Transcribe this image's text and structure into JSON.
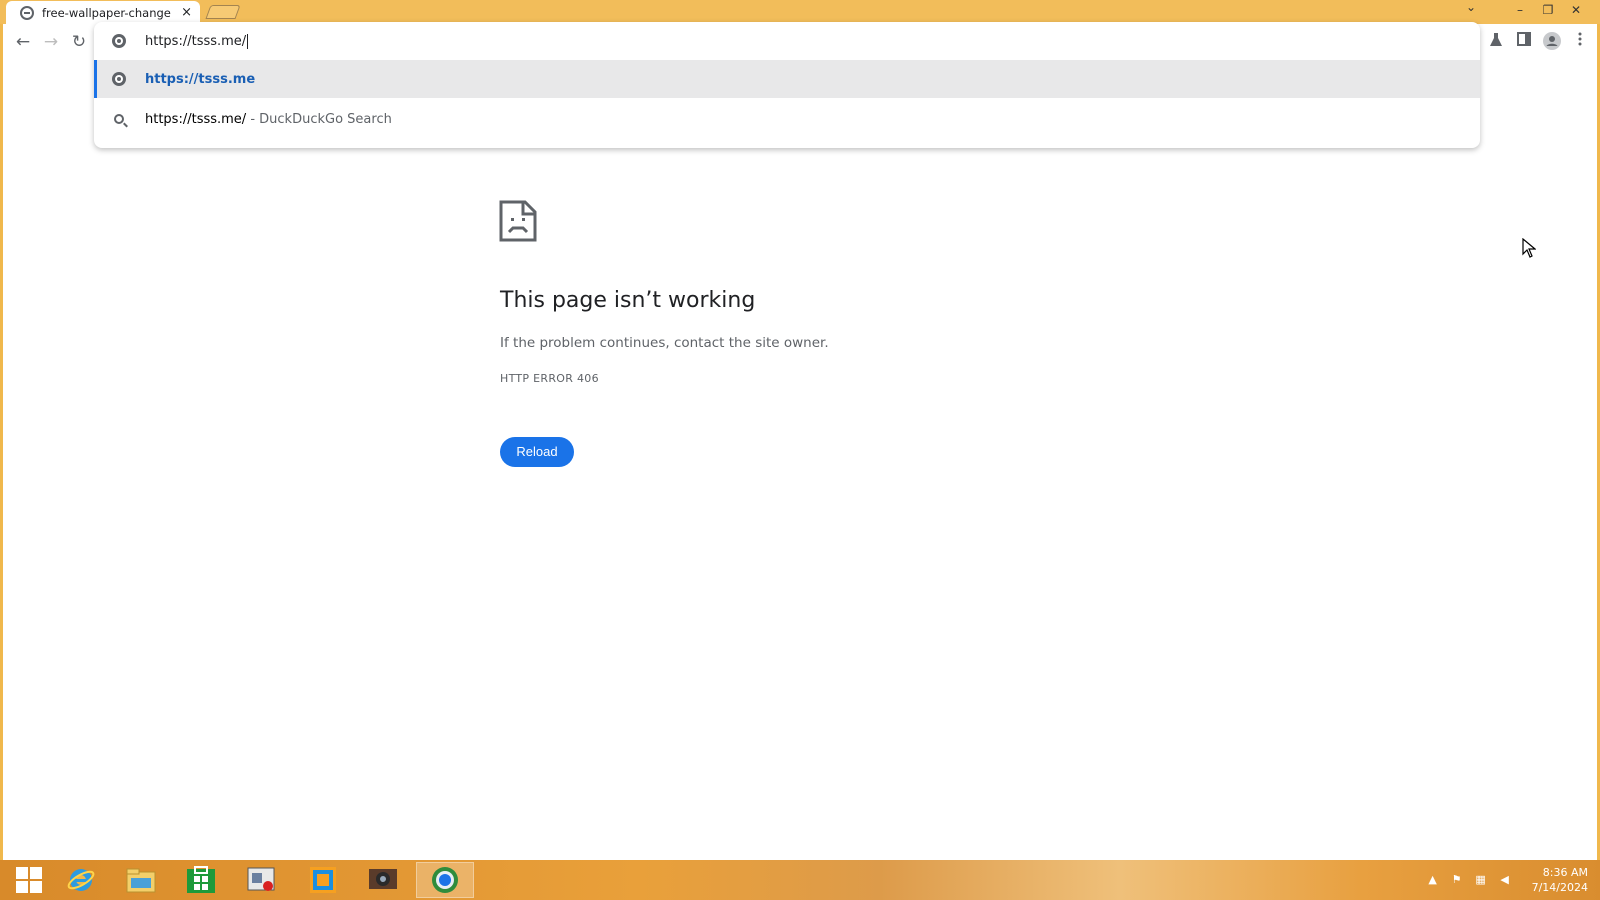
{
  "browser": {
    "tab": {
      "title": "free-wallpaper-change",
      "close_icon": "×"
    },
    "window_controls": {
      "tab_list": "⌄",
      "minimize": "–",
      "restore": "❐",
      "close": "✕"
    },
    "nav": {
      "back": "←",
      "forward": "→",
      "reload": "↻"
    },
    "omnibox": {
      "value": "https://tsss.me/",
      "suggestions": [
        {
          "text": "https://tsss.me",
          "suffix": "",
          "icon": "globe-icon",
          "selected": true
        },
        {
          "text": "https://tsss.me/",
          "suffix": " - DuckDuckGo Search",
          "icon": "search-icon",
          "selected": false
        }
      ]
    },
    "toolbar_right": [
      "flask-icon",
      "side-panel-icon",
      "profile-icon",
      "menu-icon"
    ]
  },
  "error_page": {
    "title": "This page isn’t working",
    "message": "If the problem continues, contact the site owner.",
    "code": "HTTP ERROR 406",
    "reload_label": "Reload",
    "accent": "#1a73e8"
  },
  "taskbar": {
    "apps": [
      "start-button",
      "internet-explorer",
      "file-explorer",
      "store",
      "app-recorder",
      "app-blue",
      "app-webcam",
      "app-browser"
    ],
    "clock": {
      "time": "8:36 AM",
      "date": "7/14/2024"
    }
  }
}
